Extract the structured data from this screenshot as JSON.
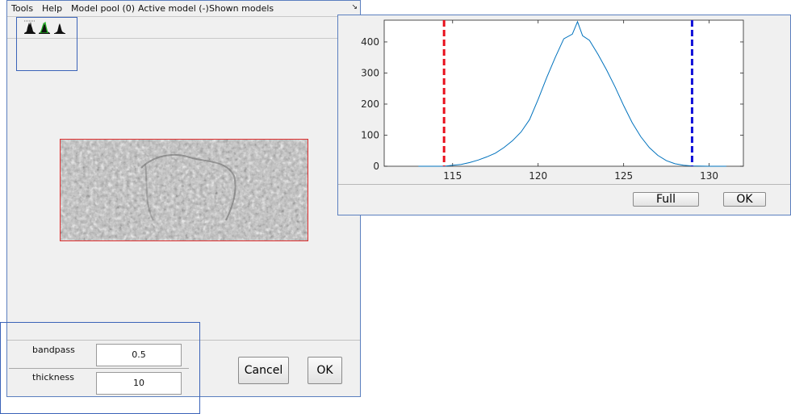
{
  "menu": {
    "tools": "Tools",
    "help": "Help",
    "model_pool": "Model pool (0)",
    "active_model": "Active model (-)",
    "shown_models": "Shown models",
    "corner_icon": "resize-arrow-icon"
  },
  "toolbar": {
    "icons": [
      "histogram-icon",
      "histogram-green-icon",
      "histogram-small-icon"
    ]
  },
  "params": {
    "bandpass_label": "bandpass",
    "bandpass_value": "0.5",
    "thickness_label": "thickness",
    "thickness_value": "10"
  },
  "buttons": {
    "cancel": "Cancel",
    "ok": "OK"
  },
  "histogram": {
    "full_label": "Full",
    "ok_label": "OK",
    "lower_cut": 114.5,
    "upper_cut": 129,
    "lower_cut_color": "#e8101c",
    "upper_cut_color": "#1010d8",
    "line_color": "#0072bd"
  },
  "chart_data": {
    "type": "line",
    "title": "",
    "xlabel": "",
    "ylabel": "",
    "xlim": [
      111,
      132
    ],
    "ylim": [
      0,
      470
    ],
    "xticks": [
      115,
      120,
      125,
      130
    ],
    "yticks": [
      0,
      100,
      200,
      300,
      400
    ],
    "grid": false,
    "series": [
      {
        "x": [
          113,
          114,
          114.5,
          115,
          115.5,
          116,
          116.5,
          117,
          117.5,
          118,
          118.5,
          119,
          119.5,
          120,
          120.5,
          121,
          121.5,
          122,
          122.3,
          122.6,
          123,
          123.5,
          124,
          124.5,
          125,
          125.5,
          126,
          126.5,
          127,
          127.5,
          128,
          128.5,
          129,
          130,
          131
        ],
        "y": [
          0,
          0,
          0,
          3,
          6,
          12,
          20,
          30,
          42,
          60,
          82,
          110,
          150,
          215,
          285,
          350,
          410,
          425,
          465,
          420,
          405,
          360,
          310,
          255,
          195,
          140,
          95,
          60,
          35,
          18,
          8,
          3,
          1,
          0,
          0
        ]
      }
    ],
    "vlines": [
      {
        "x": 114.5,
        "style": "dashed",
        "color": "red"
      },
      {
        "x": 129,
        "style": "dashed",
        "color": "blue"
      }
    ]
  }
}
